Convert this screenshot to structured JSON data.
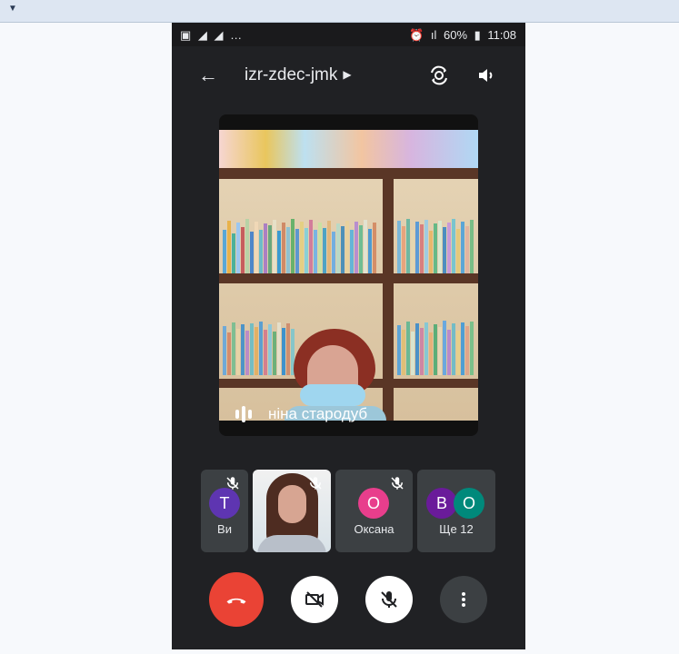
{
  "browser": {
    "dropdown_icon": "caret-down-icon"
  },
  "status_bar": {
    "left_icons": [
      "image-icon",
      "signal-icon",
      "signal-icon",
      "ellipsis-icon"
    ],
    "battery_text": "60%",
    "time": "11:08"
  },
  "call": {
    "meeting_code": "izr-zdec-jmk",
    "main_speaker_name": "ніна стародуб"
  },
  "participants": [
    {
      "initial": "Т",
      "label": "Ви",
      "color": "#5e35b1"
    },
    {
      "initial": "О",
      "label": "Оксана",
      "color": "#e83e8c"
    },
    {
      "initials": [
        "В",
        "О"
      ],
      "label": "Ще 12",
      "colors": [
        "#6a1b9a",
        "#00897b"
      ]
    }
  ],
  "controls": {
    "hangup": "phone-hangup-icon",
    "camera": "camera-off-icon",
    "microphone": "mic-off-icon",
    "more": "more-vertical-icon"
  }
}
